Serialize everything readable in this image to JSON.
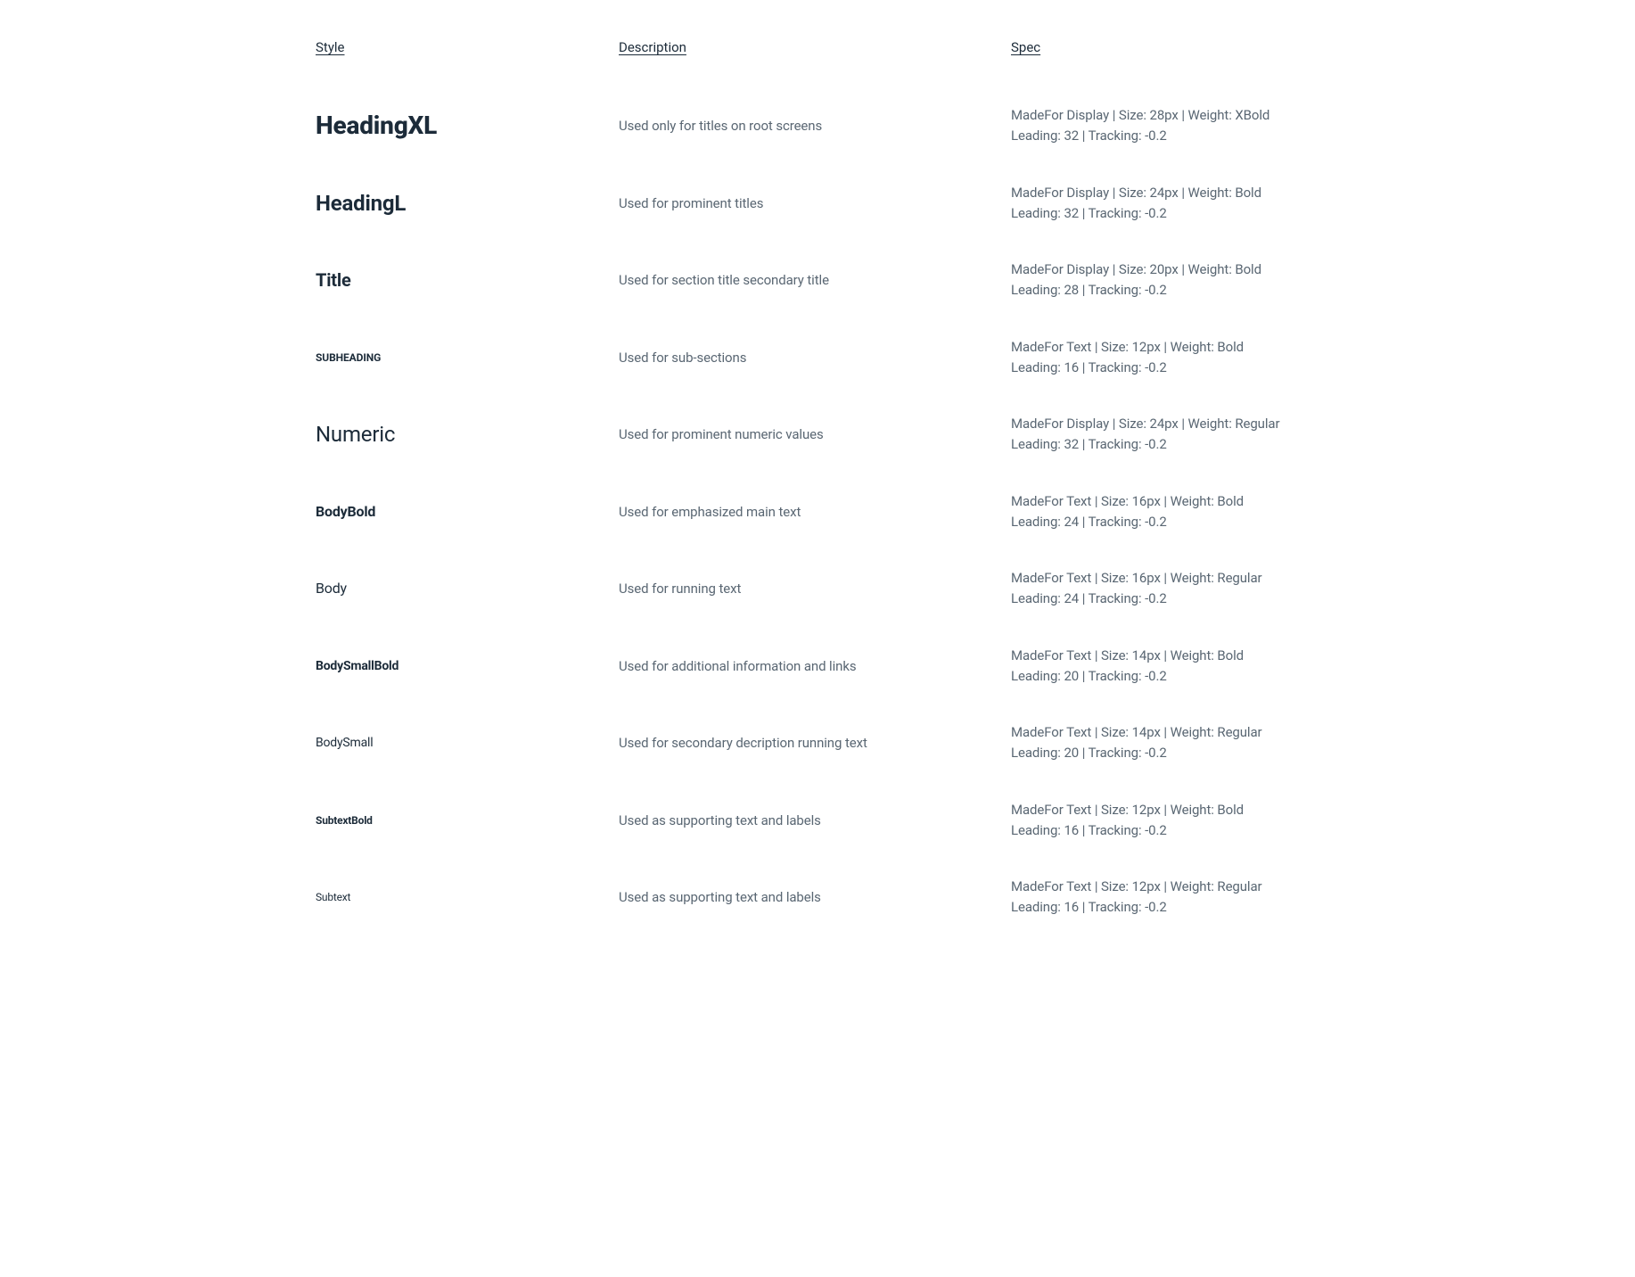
{
  "headers": {
    "style": "Style",
    "description": "Description",
    "spec": "Spec"
  },
  "rows": [
    {
      "style_name": "HeadingXL",
      "style_class": "s-heading-xl",
      "description": "Used only for titles on root screens",
      "spec_line1": "MadeFor Display  |  Size: 28px  |  Weight: XBold",
      "spec_line2": "Leading: 32  |  Tracking: -0.2"
    },
    {
      "style_name": "HeadingL",
      "style_class": "s-heading-l",
      "description": "Used for prominent titles",
      "spec_line1": "MadeFor Display  |  Size: 24px  |  Weight: Bold",
      "spec_line2": "Leading: 32  |  Tracking: -0.2"
    },
    {
      "style_name": "Title",
      "style_class": "s-title",
      "description": "Used for section title secondary title",
      "spec_line1": "MadeFor Display  |  Size: 20px  |  Weight: Bold",
      "spec_line2": "Leading: 28  |  Tracking: -0.2"
    },
    {
      "style_name": "SUBHEADING",
      "style_class": "s-subheading",
      "description": "Used for sub-sections",
      "spec_line1": "MadeFor Text  |  Size: 12px  |  Weight: Bold",
      "spec_line2": "Leading: 16  |  Tracking: -0.2"
    },
    {
      "style_name": "Numeric",
      "style_class": "s-numeric",
      "description": "Used for prominent numeric values",
      "spec_line1": "MadeFor Display  |  Size: 24px  |  Weight: Regular",
      "spec_line2": "Leading: 32  |  Tracking: -0.2"
    },
    {
      "style_name": "BodyBold",
      "style_class": "s-body-bold",
      "description": "Used for emphasized main text",
      "spec_line1": "MadeFor Text  |  Size: 16px  |  Weight: Bold",
      "spec_line2": "Leading: 24  |  Tracking: -0.2"
    },
    {
      "style_name": "Body",
      "style_class": "s-body",
      "description": "Used for running text",
      "spec_line1": "MadeFor Text  |  Size: 16px  |  Weight: Regular",
      "spec_line2": "Leading: 24  |  Tracking: -0.2"
    },
    {
      "style_name": "BodySmallBold",
      "style_class": "s-body-sm-bd",
      "description": "Used for additional information and links",
      "spec_line1": "MadeFor Text  |  Size: 14px  |  Weight: Bold",
      "spec_line2": "Leading: 20  |  Tracking: -0.2"
    },
    {
      "style_name": "BodySmall",
      "style_class": "s-body-sm",
      "description": "Used for secondary decription running text",
      "spec_line1": "MadeFor Text  |  Size: 14px  |  Weight: Regular",
      "spec_line2": "Leading: 20  |  Tracking: -0.2"
    },
    {
      "style_name": "SubtextBold",
      "style_class": "s-subtext-bd",
      "description": "Used as supporting text and labels",
      "spec_line1": "MadeFor Text  |  Size: 12px  |  Weight: Bold",
      "spec_line2": "Leading: 16  |  Tracking: -0.2"
    },
    {
      "style_name": "Subtext",
      "style_class": "s-subtext",
      "description": "Used as supporting text and labels",
      "spec_line1": "MadeFor Text  |  Size: 12px  |  Weight: Regular",
      "spec_line2": "Leading: 16  |  Tracking: -0.2"
    }
  ]
}
